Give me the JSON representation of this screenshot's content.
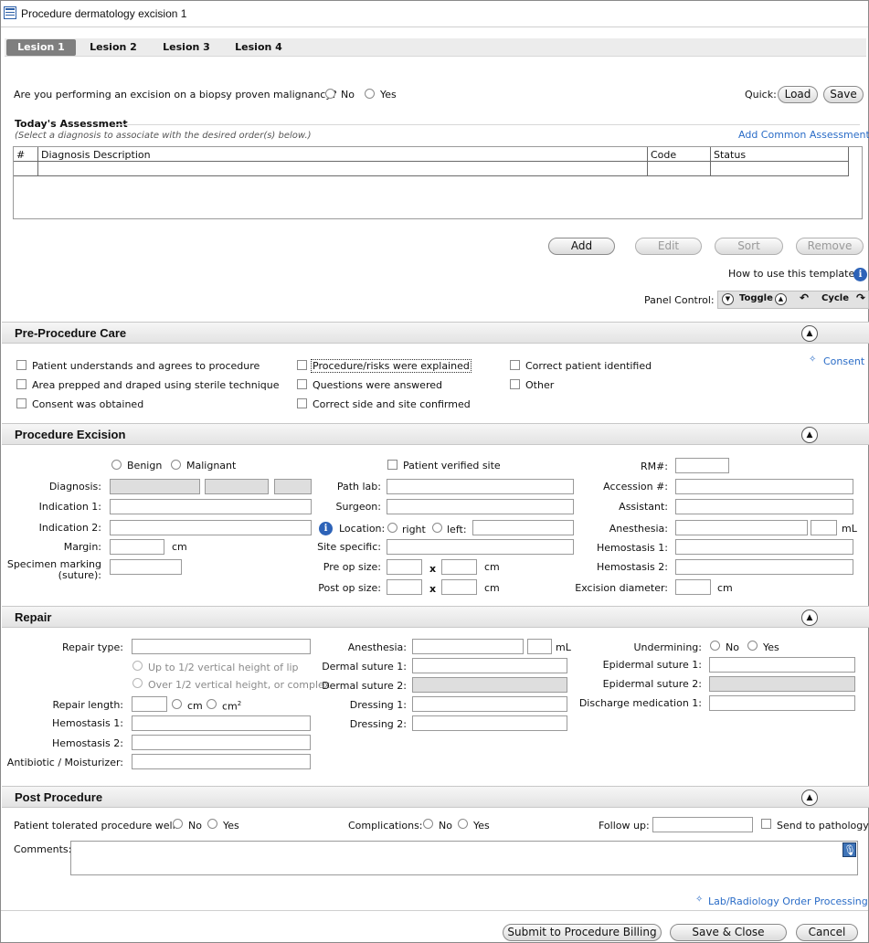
{
  "window": {
    "title": "Procedure dermatology excision 1",
    "icon": "form-icon"
  },
  "tabs": [
    "Lesion 1",
    "Lesion 2",
    "Lesion 3",
    "Lesion 4"
  ],
  "question": {
    "text": "Are you performing an excision on a biopsy proven malignancy?",
    "no": "No",
    "yes": "Yes"
  },
  "quick": {
    "label": "Quick:",
    "load": "Load",
    "save": "Save"
  },
  "assessment": {
    "title": "Today's Assessment",
    "hint": "(Select a diagnosis to associate with the desired order(s) below.)",
    "add_common": "Add Common Assessment",
    "columns": [
      "#",
      "Diagnosis Description",
      "Code",
      "Status"
    ]
  },
  "actions": {
    "add": "Add",
    "edit": "Edit",
    "sort": "Sort",
    "remove": "Remove"
  },
  "howto": "How to use this template",
  "panel": {
    "label": "Panel Control:",
    "toggle": "Toggle",
    "cycle": "Cycle"
  },
  "pre": {
    "title": "Pre-Procedure Care",
    "consent_link": "Consent",
    "c1": [
      "Patient understands and agrees to procedure",
      "Area prepped and draped using sterile technique",
      "Consent was obtained"
    ],
    "c2": [
      "Procedure/risks were explained",
      "Questions were answered",
      "Correct side and site confirmed"
    ],
    "c3": [
      "Correct patient identified",
      "Other"
    ]
  },
  "excision": {
    "title": "Procedure Excision",
    "benign": "Benign",
    "malignant": "Malignant",
    "diagnosis": "Diagnosis:",
    "ind1": "Indication 1:",
    "ind2": "Indication 2:",
    "margin": "Margin:",
    "cm": "cm",
    "specimen1": "Specimen marking",
    "specimen2": "(suture):",
    "verified": "Patient verified site",
    "path_lab": "Path lab:",
    "surgeon": "Surgeon:",
    "location": "Location:",
    "right": "right",
    "left": "left:",
    "site_specific": "Site specific:",
    "pre_op": "Pre op size:",
    "post_op": "Post op size:",
    "x": "x",
    "rm": "RM#:",
    "accession": "Accession #:",
    "assistant": "Assistant:",
    "anesthesia": "Anesthesia:",
    "ml": "mL",
    "hemo1": "Hemostasis 1:",
    "hemo2": "Hemostasis 2:",
    "diameter": "Excision diameter:"
  },
  "repair": {
    "title": "Repair",
    "type": "Repair type:",
    "up": "Up to 1/2 vertical height of lip",
    "over": "Over 1/2 vertical height, or complex",
    "length": "Repair length:",
    "cm": "cm",
    "cm2": "cm",
    "sq": "2",
    "hemo1": "Hemostasis 1:",
    "hemo2": "Hemostasis 2:",
    "antibiotic": "Antibiotic / Moisturizer:",
    "anesthesia": "Anesthesia:",
    "ml": "mL",
    "dermal1": "Dermal suture 1:",
    "dermal2": "Dermal suture 2:",
    "dressing1": "Dressing 1:",
    "dressing2": "Dressing 2:",
    "undermining": "Undermining:",
    "no": "No",
    "yes": "Yes",
    "epi1": "Epidermal suture 1:",
    "epi2": "Epidermal suture 2:",
    "discharge": "Discharge medication 1:"
  },
  "post": {
    "title": "Post Procedure",
    "tolerated": "Patient tolerated procedure well:",
    "no": "No",
    "yes": "Yes",
    "complications": "Complications:",
    "follow": "Follow up:",
    "send": "Send to pathology",
    "comments": "Comments:",
    "lab_link": "Lab/Radiology Order Processing"
  },
  "footer": {
    "submit": "Submit to Procedure Billing",
    "save_close": "Save & Close",
    "cancel": "Cancel"
  }
}
